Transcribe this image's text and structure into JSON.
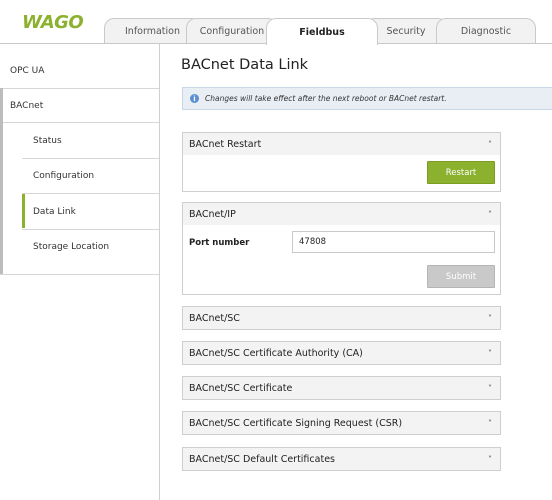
{
  "brand": {
    "logo_text": "WAGO",
    "accent_color": "#8cb12f"
  },
  "tabs": [
    {
      "label": "Information",
      "active": false
    },
    {
      "label": "Configuration",
      "active": false
    },
    {
      "label": "Fieldbus",
      "active": true
    },
    {
      "label": "Security",
      "active": false
    },
    {
      "label": "Diagnostic",
      "active": false
    }
  ],
  "sidebar": {
    "items": [
      {
        "label": "OPC UA",
        "level": 0
      },
      {
        "label": "BACnet",
        "level": 0
      },
      {
        "label": "Status",
        "level": 1
      },
      {
        "label": "Configuration",
        "level": 1
      },
      {
        "label": "Data Link",
        "level": 1,
        "active": true
      },
      {
        "label": "Storage Location",
        "level": 1
      }
    ]
  },
  "main": {
    "title": "BACnet Data Link",
    "info_icon": "info-icon",
    "info_text": "Changes will take effect after the next reboot or BACnet restart.",
    "restart_panel": {
      "title": "BACnet Restart",
      "button": "Restart",
      "expanded": true
    },
    "ip_panel": {
      "title": "BACnet/IP",
      "expanded": true,
      "port_label": "Port number",
      "port_value": "47808",
      "submit": "Submit"
    },
    "collapsed_panels": [
      {
        "title": "BACnet/SC"
      },
      {
        "title": "BACnet/SC Certificate Authority (CA)"
      },
      {
        "title": "BACnet/SC Certificate"
      },
      {
        "title": "BACnet/SC Certificate Signing Request (CSR)"
      },
      {
        "title": "BACnet/SC Default Certificates"
      }
    ]
  }
}
